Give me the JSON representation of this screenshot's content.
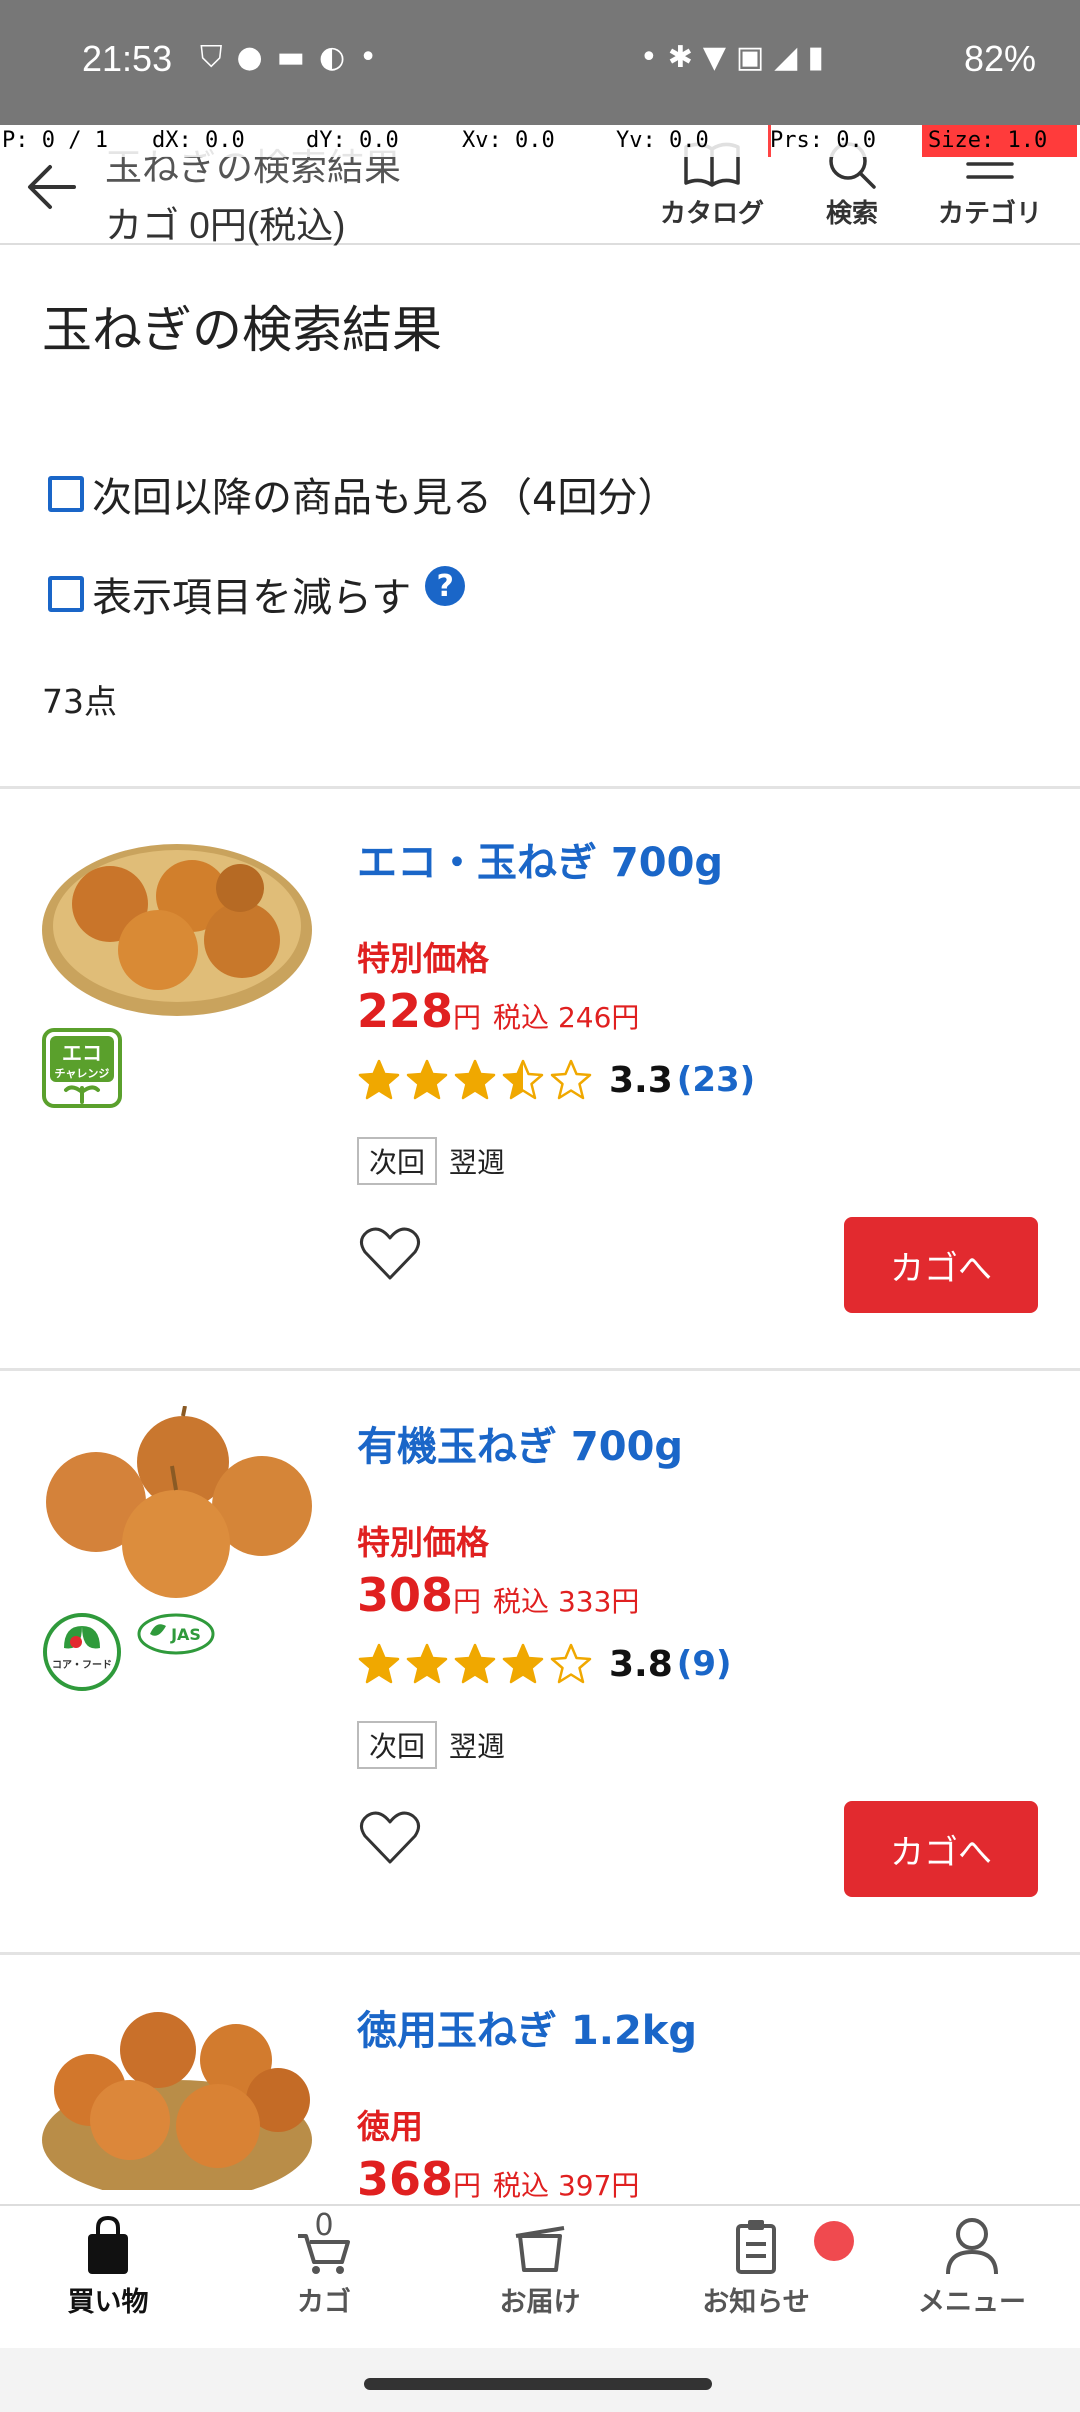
{
  "status_bar": {
    "time": "21:53",
    "battery": "82%",
    "left_icons": [
      "vpn-icon",
      "pig-icon",
      "line-icon",
      "sync-icon",
      "dot-icon"
    ],
    "right_icons": [
      "dot-icon",
      "bluetooth-icon",
      "wifi-icon",
      "volte-icon",
      "signal-icon",
      "battery-icon"
    ]
  },
  "debug_overlay": {
    "p": "P: 0 / 1",
    "dx": "dX: 0.0",
    "dy": "dY: 0.0",
    "xv": "Xv: 0.0",
    "yv": "Yv: 0.0",
    "prs": "Prs: 0.0",
    "size": "Size: 1.0"
  },
  "header": {
    "title": "玉ねぎの検索結果",
    "cart_summary": "カゴ 0円(税込)",
    "catalog_label": "カタログ",
    "search_label": "検索",
    "category_label": "カテゴリ"
  },
  "page": {
    "title": "玉ねぎの検索結果",
    "show_future_label": "次回以降の商品も見る（4回分）",
    "reduce_items_label": "表示項目を減らす",
    "help_glyph": "?",
    "result_count": "73点"
  },
  "products": [
    {
      "name": "エコ・玉ねぎ 700g",
      "price_tag": "特別価格",
      "price": "228",
      "yen": "円",
      "tax_price": "税込 246円",
      "rating": "3.3",
      "rating_value": 3.3,
      "review_count": "(23)",
      "delivery_label": "次回",
      "delivery_week": "翌週",
      "add_label": "カゴへ",
      "badges": [
        "eco-challenge-badge"
      ],
      "eco_badge_line1": "エコ",
      "eco_badge_line2": "チャレンジ"
    },
    {
      "name": "有機玉ねぎ 700g",
      "price_tag": "特別価格",
      "price": "308",
      "yen": "円",
      "tax_price": "税込 333円",
      "rating": "3.8",
      "rating_value": 3.8,
      "review_count": "(9)",
      "delivery_label": "次回",
      "delivery_week": "翌週",
      "add_label": "カゴへ",
      "badges": [
        "core-food-badge",
        "jas-organic-badge"
      ],
      "core_food_text": "コア・フード",
      "jas_text": "JAS"
    },
    {
      "name": "徳用玉ねぎ 1.2kg",
      "price_tag": "徳用",
      "price": "368",
      "yen": "円",
      "tax_price": "税込 397円"
    }
  ],
  "bottom_nav": {
    "shopping_label": "買い物",
    "cart_label": "カゴ",
    "cart_count": "0",
    "delivery_label": "お届け",
    "notice_label": "お知らせ",
    "menu_label": "メニュー"
  },
  "colors": {
    "accent_blue": "#1a66c8",
    "price_red": "#e02020",
    "button_red": "#e22a2f",
    "star_gold": "#f0a800"
  }
}
